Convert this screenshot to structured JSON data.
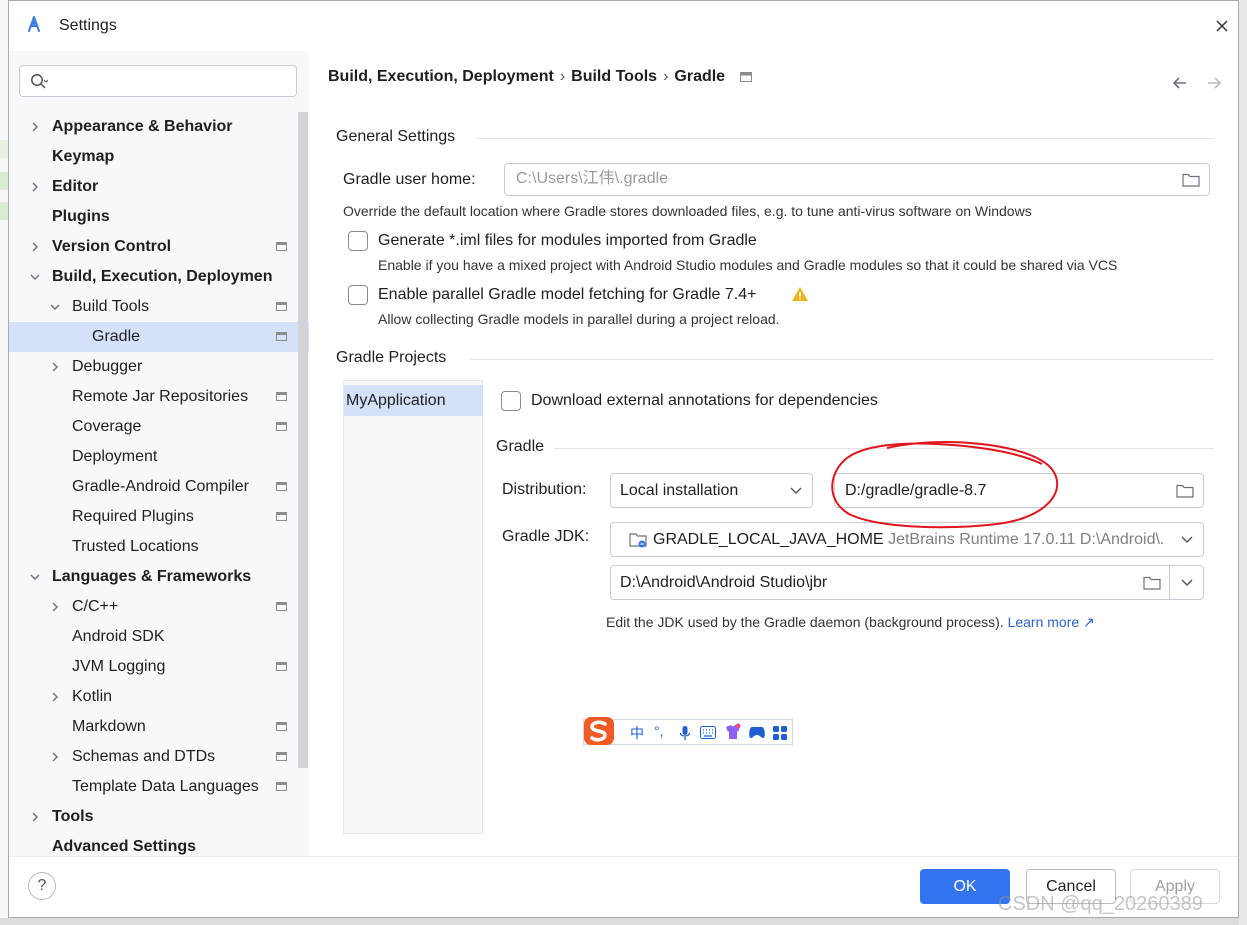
{
  "window": {
    "title": "Settings"
  },
  "search": {
    "placeholder": ""
  },
  "sidebar": {
    "items": [
      {
        "label": "Appearance & Behavior",
        "level": 0,
        "bold": true,
        "expandable": true,
        "expanded": false,
        "project": false
      },
      {
        "label": "Keymap",
        "level": 0,
        "bold": true,
        "expandable": false,
        "project": false
      },
      {
        "label": "Editor",
        "level": 0,
        "bold": true,
        "expandable": true,
        "expanded": false,
        "project": false
      },
      {
        "label": "Plugins",
        "level": 0,
        "bold": true,
        "expandable": false,
        "project": false
      },
      {
        "label": "Version Control",
        "level": 0,
        "bold": true,
        "expandable": true,
        "expanded": false,
        "project": true
      },
      {
        "label": "Build, Execution, Deploymen",
        "level": 0,
        "bold": true,
        "expandable": true,
        "expanded": true,
        "project": false
      },
      {
        "label": "Build Tools",
        "level": 1,
        "bold": false,
        "expandable": true,
        "expanded": true,
        "project": true
      },
      {
        "label": "Gradle",
        "level": 2,
        "bold": false,
        "expandable": false,
        "project": true,
        "selected": true
      },
      {
        "label": "Debugger",
        "level": 1,
        "bold": false,
        "expandable": true,
        "expanded": false,
        "project": false
      },
      {
        "label": "Remote Jar Repositories",
        "level": 1,
        "bold": false,
        "expandable": false,
        "project": true
      },
      {
        "label": "Coverage",
        "level": 1,
        "bold": false,
        "expandable": false,
        "project": true
      },
      {
        "label": "Deployment",
        "level": 1,
        "bold": false,
        "expandable": false,
        "project": false
      },
      {
        "label": "Gradle-Android Compiler",
        "level": 1,
        "bold": false,
        "expandable": false,
        "project": true
      },
      {
        "label": "Required Plugins",
        "level": 1,
        "bold": false,
        "expandable": false,
        "project": true
      },
      {
        "label": "Trusted Locations",
        "level": 1,
        "bold": false,
        "expandable": false,
        "project": false
      },
      {
        "label": "Languages & Frameworks",
        "level": 0,
        "bold": true,
        "expandable": true,
        "expanded": true,
        "project": false
      },
      {
        "label": "C/C++",
        "level": 1,
        "bold": false,
        "expandable": true,
        "expanded": false,
        "project": true
      },
      {
        "label": "Android SDK",
        "level": 1,
        "bold": false,
        "expandable": false,
        "project": false
      },
      {
        "label": "JVM Logging",
        "level": 1,
        "bold": false,
        "expandable": false,
        "project": true
      },
      {
        "label": "Kotlin",
        "level": 1,
        "bold": false,
        "expandable": true,
        "expanded": false,
        "project": false
      },
      {
        "label": "Markdown",
        "level": 1,
        "bold": false,
        "expandable": false,
        "project": true
      },
      {
        "label": "Schemas and DTDs",
        "level": 1,
        "bold": false,
        "expandable": true,
        "expanded": false,
        "project": true
      },
      {
        "label": "Template Data Languages",
        "level": 1,
        "bold": false,
        "expandable": false,
        "project": true
      },
      {
        "label": "Tools",
        "level": 0,
        "bold": true,
        "expandable": true,
        "expanded": false,
        "project": false
      },
      {
        "label": "Advanced Settings",
        "level": 0,
        "bold": true,
        "expandable": false,
        "project": false
      }
    ]
  },
  "breadcrumb": {
    "part1": "Build, Execution, Deployment",
    "part2": "Build Tools",
    "part3": "Gradle",
    "separator": "›"
  },
  "general": {
    "title": "General Settings",
    "user_home_label": "Gradle user home:",
    "user_home_value": "C:\\Users\\江伟\\.gradle",
    "user_home_hint": "Override the default location where Gradle stores downloaded files, e.g. to tune anti-virus software on Windows",
    "iml_label": "Generate *.iml files for modules imported from Gradle",
    "iml_hint": "Enable if you have a mixed project with Android Studio modules and Gradle modules so that it could be shared via VCS",
    "iml_checked": false,
    "parallel_label": "Enable parallel Gradle model fetching for Gradle 7.4+",
    "parallel_hint": "Allow collecting Gradle models in parallel during a project reload.",
    "parallel_checked": false
  },
  "projects": {
    "title": "Gradle Projects",
    "list": [
      "MyApplication"
    ],
    "annotations_label": "Download external annotations for dependencies",
    "annotations_checked": false,
    "gradle_section": "Gradle",
    "distribution_label": "Distribution:",
    "distribution_value": "Local installation",
    "distribution_path": "D:/gradle/gradle-8.7",
    "jdk_label": "Gradle JDK:",
    "jdk_name": "GRADLE_LOCAL_JAVA_HOME",
    "jdk_detail": "JetBrains Runtime 17.0.11 D:\\Android\\.",
    "jdk_path": "D:\\Android\\Android Studio\\jbr",
    "jdk_hint": "Edit the JDK used by the Gradle daemon (background process).",
    "learn_more": "Learn more ↗"
  },
  "ime": {
    "lang": "中",
    "punct": "°,"
  },
  "footer": {
    "help": "?",
    "ok": "OK",
    "cancel": "Cancel",
    "apply": "Apply"
  },
  "watermark": "CSDN @qq_20260389",
  "colors": {
    "accent": "#3574f0",
    "selection": "#d5e1f8",
    "annotation": "#e0141c",
    "warning": "#f2b51d",
    "link": "#2c62c9"
  }
}
